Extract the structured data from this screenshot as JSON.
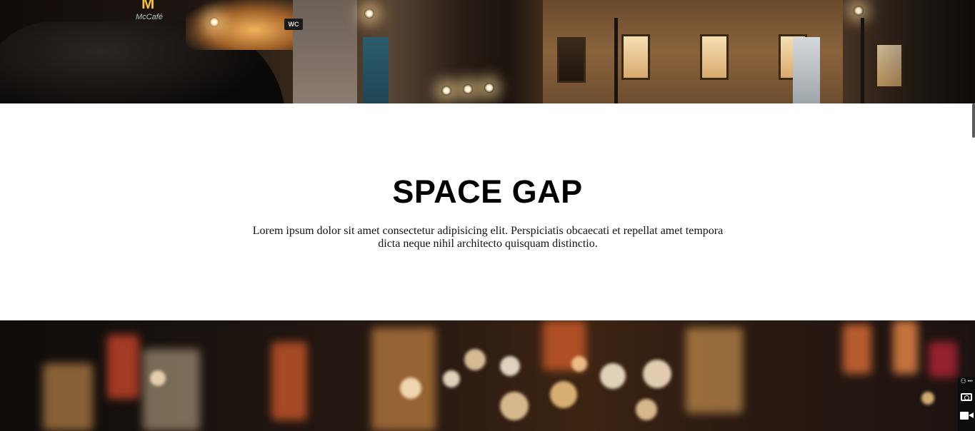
{
  "hero_top": {
    "image_alt_icon": "city-street-night-photo",
    "storefront_sign": "McCafé",
    "storefront_logo": "M",
    "wc_sign": "WC"
  },
  "section": {
    "title": "SPACE GAP",
    "description": "Lorem ipsum dolor sit amet consectetur adipisicing elit. Perspiciatis obcaecati et repellat amet tempora dicta neque nihil architecto quisquam distinctio."
  },
  "hero_bottom": {
    "image_alt_icon": "blurred-city-lights-photo"
  },
  "side_widget": {
    "menu_label": "⚇ ···",
    "icons": [
      "link-icon",
      "more-icon",
      "camera-icon",
      "video-camera-icon"
    ]
  },
  "colors": {
    "background": "#ffffff",
    "title": "#000000",
    "text": "#111111",
    "widget_bg": "#0d0d0d"
  }
}
